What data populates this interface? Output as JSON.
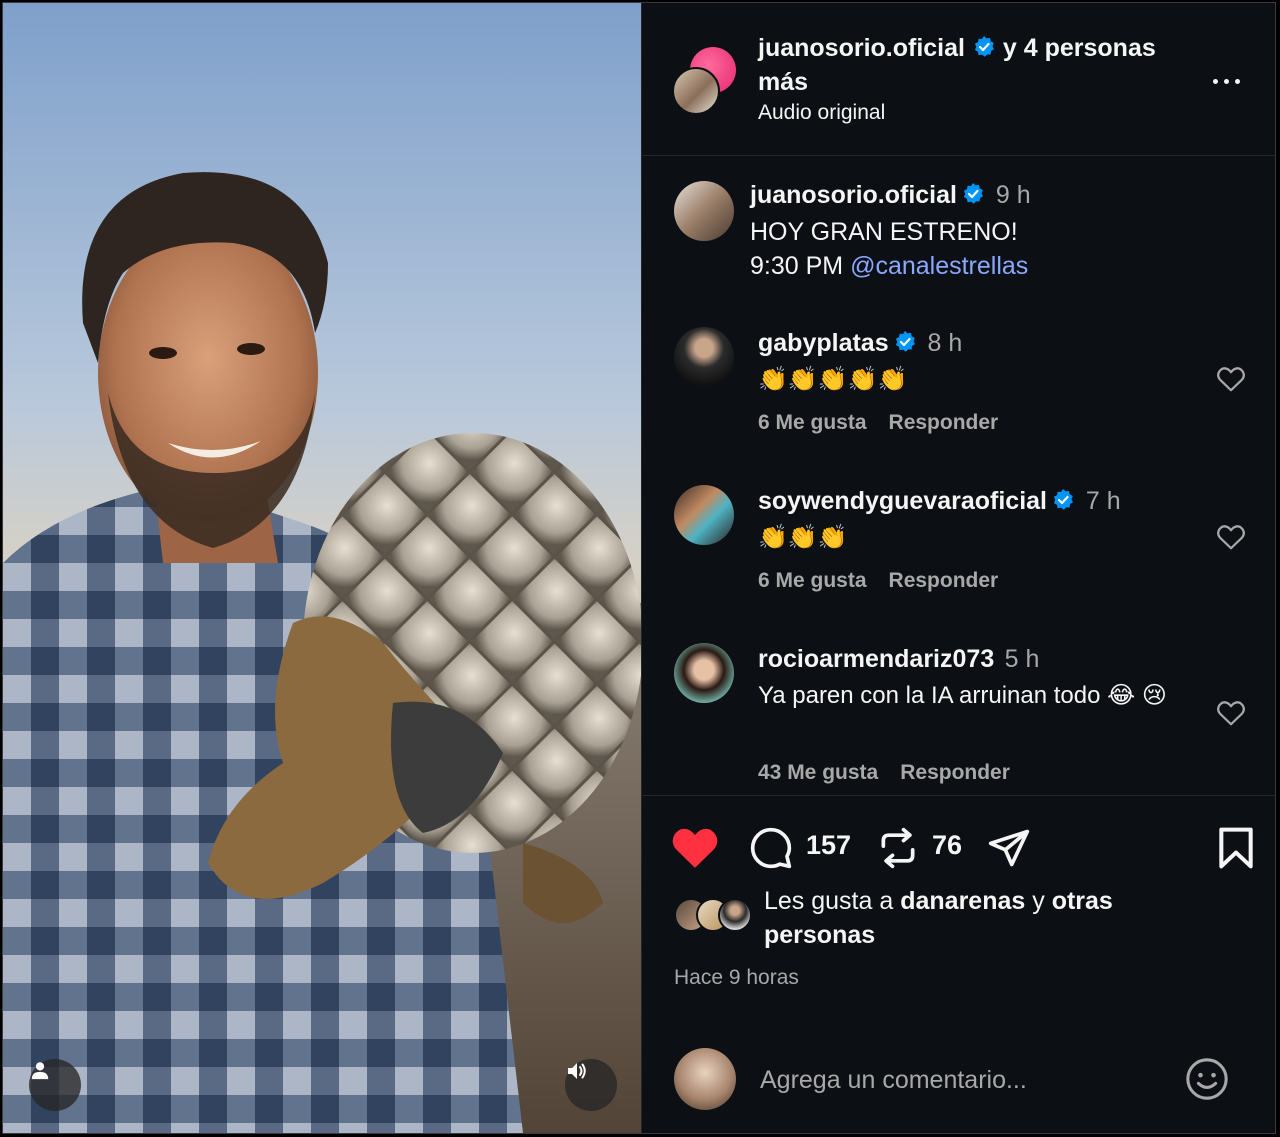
{
  "post_header": {
    "author": "juanosorio.oficial",
    "coauthors_text": "y 4 personas más",
    "audio": "Audio original"
  },
  "caption": {
    "user": "juanosorio.oficial",
    "time": "9 h",
    "line1": "HOY GRAN ESTRENO!",
    "line2": "9:30 PM",
    "mention": "@canalestrellas"
  },
  "comments": [
    {
      "user": "gabyplatas",
      "verified": true,
      "time": "8 h",
      "text": "👏👏👏👏👏",
      "likes": "6 Me gusta",
      "reply": "Responder"
    },
    {
      "user": "soywendyguevaraoficial",
      "verified": true,
      "time": "7 h",
      "text": "👏👏👏",
      "likes": "6 Me gusta",
      "reply": "Responder"
    },
    {
      "user": "rocioarmendariz073",
      "verified": false,
      "time": "5 h",
      "text": "Ya paren con la IA arruinan todo 😂 😢",
      "likes": "43 Me gusta",
      "reply": "Responder"
    }
  ],
  "actions": {
    "comment_count": "157",
    "repost_count": "76"
  },
  "likes": {
    "prefix": "Les gusta a",
    "user": "danarenas",
    "middle": "y",
    "suffix": "otras personas"
  },
  "posted_ago": "Hace 9 horas",
  "compose": {
    "placeholder": "Agrega un comentario..."
  },
  "colors": {
    "background": "#0c1014",
    "verified": "#0095f6",
    "like_red": "#ff3040",
    "mention": "#8ba8ff",
    "muted_text": "#a8a8a8"
  },
  "icons": [
    "verified-badge-icon",
    "more-options-icon",
    "heart-icon",
    "comment-icon",
    "repost-icon",
    "share-icon",
    "bookmark-icon",
    "emoji-icon",
    "user-icon",
    "volume-icon"
  ]
}
